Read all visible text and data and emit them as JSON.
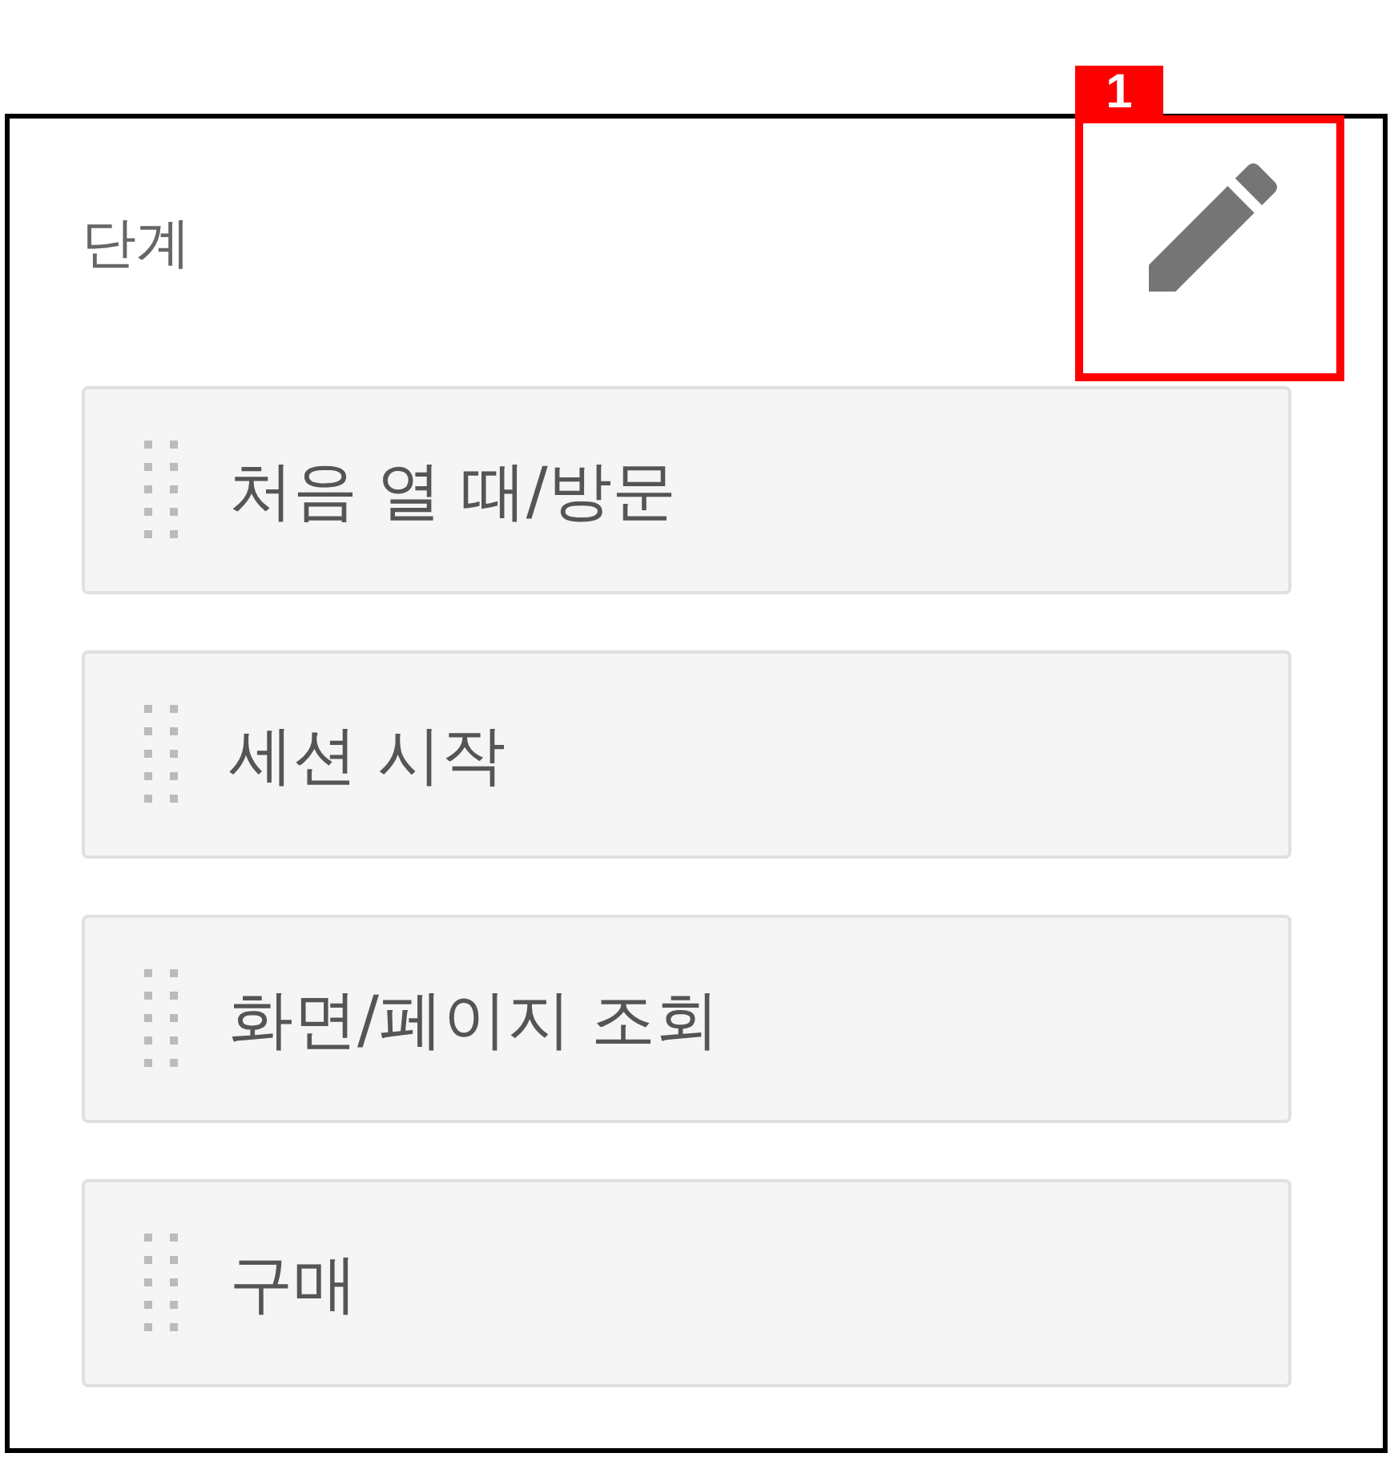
{
  "panel": {
    "title": "단계"
  },
  "callout": {
    "label": "1"
  },
  "steps": [
    {
      "label": "처음 열 때/방문"
    },
    {
      "label": "세션 시작"
    },
    {
      "label": "화면/페이지 조회"
    },
    {
      "label": "구매"
    }
  ]
}
